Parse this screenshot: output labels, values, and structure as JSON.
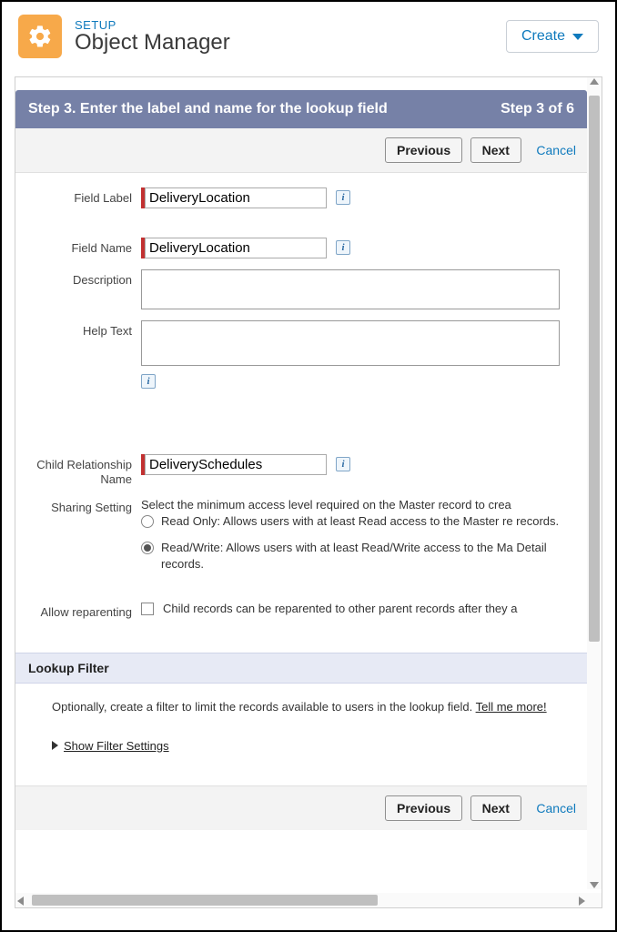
{
  "header": {
    "setup_label": "SETUP",
    "page_title": "Object Manager",
    "create_label": "Create"
  },
  "stepbar": {
    "title": "Step 3. Enter the label and name for the lookup field",
    "counter": "Step 3 of 6"
  },
  "buttons": {
    "previous": "Previous",
    "next": "Next",
    "cancel": "Cancel"
  },
  "form": {
    "field_label_lab": "Field Label",
    "field_label_val": "DeliveryLocation",
    "field_name_lab": "Field Name",
    "field_name_val": "DeliveryLocation",
    "description_lab": "Description",
    "help_text_lab": "Help Text",
    "child_rel_lab": "Child Relationship Name",
    "child_rel_val": "DeliverySchedules",
    "sharing_lab": "Sharing Setting",
    "sharing_intro": "Select the minimum access level required on the Master record to crea",
    "sharing_ro": "Read Only: Allows users with at least Read access to the Master re records.",
    "sharing_rw": "Read/Write: Allows users with at least Read/Write access to the Ma Detail records.",
    "reparent_lab": "Allow reparenting",
    "reparent_txt": "Child records can be reparented to other parent records after they a"
  },
  "lookup_filter": {
    "header": "Lookup Filter",
    "desc": "Optionally, create a filter to limit the records available to users in the lookup field.  ",
    "tell_me_more": "Tell me more!",
    "show_settings": "Show Filter Settings"
  }
}
